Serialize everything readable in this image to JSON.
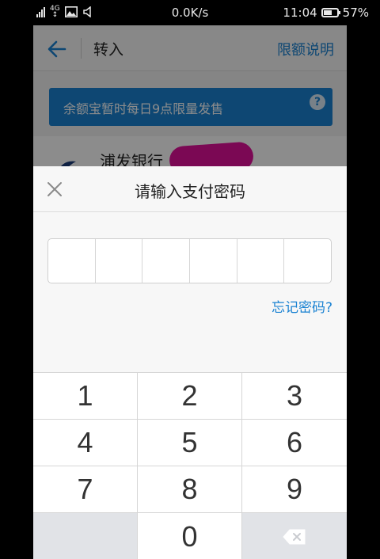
{
  "status_bar": {
    "network": "4G",
    "speed": "0.0K/s",
    "time": "11:04",
    "battery": "57%"
  },
  "nav": {
    "title": "转入",
    "right_link": "限额说明"
  },
  "notice": {
    "text": "余额宝暂时每日9点限量发售",
    "help": "?"
  },
  "bank": {
    "name": "浦发银行"
  },
  "dialog": {
    "title": "请输入支付密码",
    "forgot": "忘记密码?",
    "cells": 6
  },
  "keypad": {
    "keys": [
      "1",
      "2",
      "3",
      "4",
      "5",
      "6",
      "7",
      "8",
      "9",
      "0"
    ]
  },
  "colors": {
    "accent": "#1a82d2",
    "redaction": "#e0109a"
  }
}
